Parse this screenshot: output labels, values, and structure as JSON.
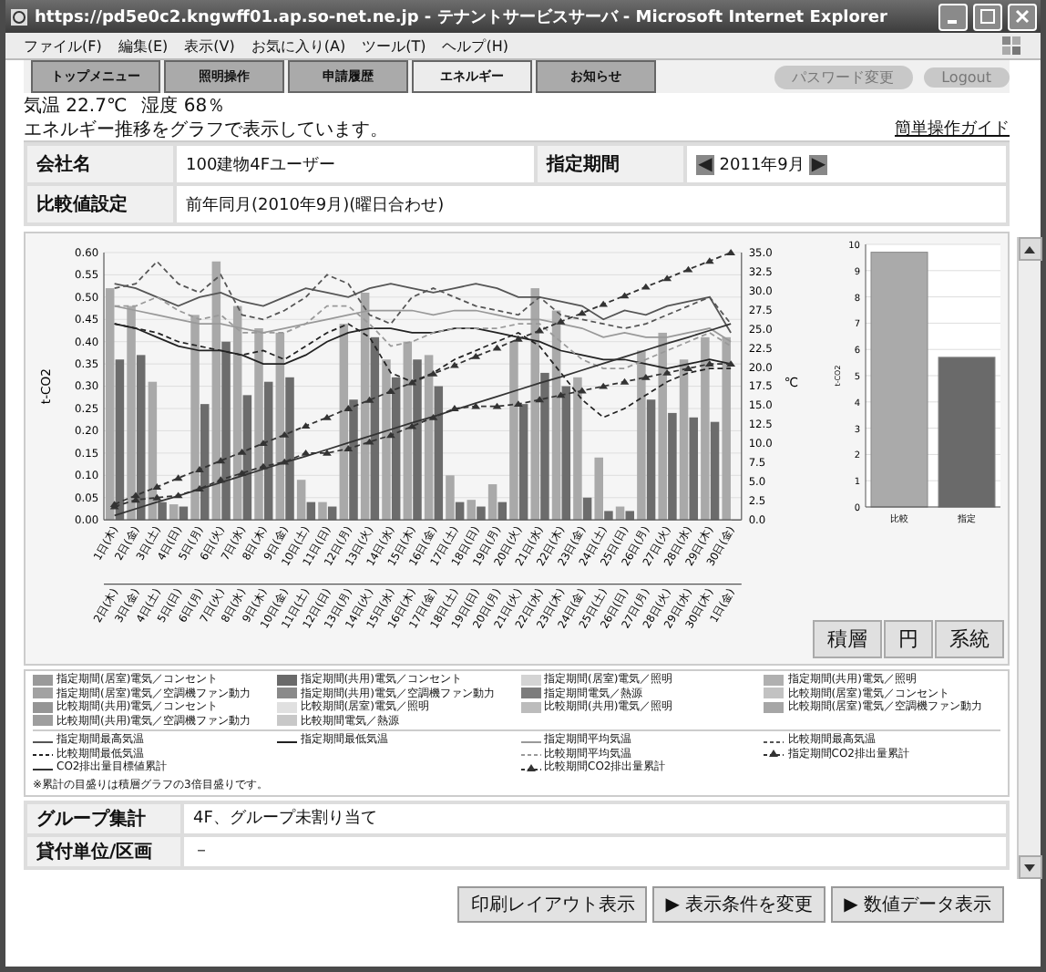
{
  "window": {
    "title": "https://pd5e0c2.kngwff01.ap.so-net.ne.jp - テナントサービスサーバ - Microsoft Internet Explorer"
  },
  "menu": [
    "ファイル(F)",
    "編集(E)",
    "表示(V)",
    "お気に入り(A)",
    "ツール(T)",
    "ヘルプ(H)"
  ],
  "nav_tabs": [
    {
      "label": "トップメニュー",
      "selected": false
    },
    {
      "label": "照明操作",
      "selected": false
    },
    {
      "label": "申請履歴",
      "selected": false
    },
    {
      "label": "エネルギー",
      "selected": true
    },
    {
      "label": "お知らせ",
      "selected": false
    }
  ],
  "nav_buttons": [
    "パスワード変更",
    "Logout"
  ],
  "weather": {
    "temperature": "気温 22.7℃",
    "humidity": "湿度 68％"
  },
  "heading": "エネルギー推移をグラフで表示しています。",
  "guide_link": "簡単操作ガイド",
  "info": {
    "company_label": "会社名",
    "company": "100建物4Fユーザー",
    "period_label": "指定期間",
    "prev": "◀",
    "period": "2011年9月",
    "next": "▶",
    "compare_label": "比較値設定",
    "compare": "前年同月(2010年9月)(曜日合わせ)"
  },
  "energy_chart": {
    "chart_data": {
      "type": "bar",
      "ylabel": "t-CO2",
      "grid": true,
      "categories": [
        "1日(木)",
        "2日(金)",
        "3日(土)",
        "4日(日)",
        "5日(月)",
        "6日(火)",
        "7日(水)",
        "8日(木)",
        "9日(金)",
        "10日(土)",
        "11日(日)",
        "12日(月)",
        "13日(火)",
        "14日(水)",
        "15日(木)",
        "16日(金)",
        "17日(土)",
        "18日(日)",
        "19日(月)",
        "20日(火)",
        "21日(水)",
        "22日(木)",
        "23日(金)",
        "24日(土)",
        "25日(日)",
        "26日(月)",
        "27日(火)",
        "28日(水)",
        "29日(木)",
        "30日(金)"
      ],
      "series": [
        {
          "type": "bar",
          "color": "#a9a9a9",
          "values": [
            0.52,
            0.48,
            0.31,
            0.035,
            0.46,
            0.58,
            0.48,
            0.43,
            0.42,
            0.09,
            0.04,
            0.44,
            0.51,
            0.36,
            0.4,
            0.37,
            0.1,
            0.045,
            0.08,
            0.4,
            0.52,
            0.47,
            0.32,
            0.14,
            0.03,
            0.38,
            0.42,
            0.36,
            0.41,
            0.41
          ]
        },
        {
          "type": "bar",
          "color": "#6c6c6c",
          "values": [
            0.36,
            0.37,
            0.04,
            0.03,
            0.26,
            0.4,
            0.28,
            0.31,
            0.32,
            0.04,
            0.03,
            0.27,
            0.41,
            0.32,
            0.36,
            0.3,
            0.04,
            0.03,
            0.04,
            0.26,
            0.33,
            0.3,
            0.05,
            0.02,
            0.02,
            0.27,
            0.24,
            0.23,
            0.22,
            0.0
          ]
        },
        {
          "type": "line",
          "name": "指定期間最高気温",
          "color": "#555555",
          "line_style": "solid",
          "values": [
            0.53,
            0.52,
            0.5,
            0.48,
            0.5,
            0.51,
            0.49,
            0.48,
            0.5,
            0.52,
            0.51,
            0.5,
            0.52,
            0.53,
            0.52,
            0.51,
            0.52,
            0.53,
            0.52,
            0.5,
            0.5,
            0.49,
            0.48,
            0.45,
            0.47,
            0.46,
            0.48,
            0.49,
            0.5,
            0.42
          ]
        },
        {
          "type": "line",
          "name": "指定期間最低気温",
          "color": "#222222",
          "line_style": "solid",
          "values": [
            0.44,
            0.43,
            0.41,
            0.39,
            0.38,
            0.38,
            0.37,
            0.35,
            0.35,
            0.37,
            0.4,
            0.42,
            0.43,
            0.43,
            0.42,
            0.42,
            0.43,
            0.43,
            0.42,
            0.41,
            0.4,
            0.38,
            0.37,
            0.36,
            0.36,
            0.35,
            0.34,
            0.35,
            0.36,
            0.35
          ]
        },
        {
          "type": "line",
          "name": "指定期間平均気温",
          "color": "#999999",
          "line_style": "solid",
          "values": [
            0.48,
            0.47,
            0.46,
            0.45,
            0.44,
            0.44,
            0.43,
            0.42,
            0.43,
            0.44,
            0.45,
            0.46,
            0.47,
            0.47,
            0.47,
            0.46,
            0.47,
            0.47,
            0.46,
            0.45,
            0.45,
            0.44,
            0.43,
            0.41,
            0.42,
            0.41,
            0.41,
            0.42,
            0.43,
            0.4
          ]
        },
        {
          "type": "line",
          "name": "比較期間最高気温",
          "color": "#555555",
          "line_style": "dashed",
          "values": [
            0.52,
            0.53,
            0.58,
            0.53,
            0.51,
            0.55,
            0.46,
            0.45,
            0.47,
            0.5,
            0.55,
            0.53,
            0.46,
            0.44,
            0.5,
            0.52,
            0.5,
            0.48,
            0.47,
            0.46,
            0.5,
            0.46,
            0.45,
            0.44,
            0.43,
            0.44,
            0.46,
            0.48,
            0.5,
            0.44
          ]
        },
        {
          "type": "line",
          "name": "比較期間最低気温",
          "color": "#222222",
          "line_style": "dashed",
          "values": [
            0.44,
            0.43,
            0.42,
            0.4,
            0.39,
            0.38,
            0.37,
            0.38,
            0.36,
            0.39,
            0.42,
            0.44,
            0.41,
            0.33,
            0.31,
            0.33,
            0.36,
            0.38,
            0.4,
            0.42,
            0.39,
            0.33,
            0.27,
            0.23,
            0.25,
            0.28,
            0.31,
            0.33,
            0.34,
            0.34
          ]
        },
        {
          "type": "line",
          "name": "比較期間平均気温",
          "color": "#999999",
          "line_style": "dashed",
          "values": [
            0.48,
            0.48,
            0.5,
            0.47,
            0.45,
            0.46,
            0.42,
            0.42,
            0.42,
            0.44,
            0.48,
            0.48,
            0.44,
            0.39,
            0.4,
            0.42,
            0.43,
            0.43,
            0.43,
            0.44,
            0.44,
            0.4,
            0.36,
            0.34,
            0.34,
            0.36,
            0.38,
            0.4,
            0.42,
            0.39
          ]
        },
        {
          "type": "line",
          "name": "指定期間CO2排出量累計",
          "color": "#333333",
          "line_style": "dashed",
          "marker": "triangle",
          "values": [
            0.035,
            0.055,
            0.074,
            0.094,
            0.113,
            0.133,
            0.152,
            0.172,
            0.191,
            0.211,
            0.23,
            0.25,
            0.269,
            0.289,
            0.308,
            0.328,
            0.347,
            0.367,
            0.386,
            0.406,
            0.425,
            0.445,
            0.464,
            0.484,
            0.503,
            0.523,
            0.542,
            0.562,
            0.581,
            0.6
          ]
        },
        {
          "type": "line",
          "name": "CO2排出量目標値累計",
          "color": "#333333",
          "line_style": "solid",
          "values": [
            0.01,
            0.025,
            0.04,
            0.054,
            0.069,
            0.084,
            0.099,
            0.114,
            0.129,
            0.143,
            0.158,
            0.173,
            0.188,
            0.203,
            0.218,
            0.232,
            0.247,
            0.262,
            0.277,
            0.292,
            0.307,
            0.321,
            0.336,
            0.351,
            0.366,
            0.381,
            0.396,
            0.41,
            0.425,
            0.44
          ]
        },
        {
          "type": "line",
          "name": "比較期間CO2排出量累計",
          "color": "#333333",
          "line_style": "dashed",
          "marker": "triangle",
          "values": [
            0.03,
            0.045,
            0.05,
            0.055,
            0.07,
            0.09,
            0.105,
            0.12,
            0.13,
            0.15,
            0.15,
            0.16,
            0.175,
            0.19,
            0.21,
            0.23,
            0.25,
            0.255,
            0.255,
            0.26,
            0.27,
            0.28,
            0.29,
            0.3,
            0.31,
            0.32,
            0.33,
            0.34,
            0.35,
            0.35
          ]
        }
      ],
      "ylim": [
        0,
        0.6
      ],
      "yticks": [
        {
          "value": 0.6,
          "label": "0.60"
        },
        {
          "value": 0.55,
          "label": "0.55"
        },
        {
          "value": 0.5,
          "label": "0.50"
        },
        {
          "value": 0.45,
          "label": "0.45"
        },
        {
          "value": 0.4,
          "label": "0.40"
        },
        {
          "value": 0.35,
          "label": "0.35"
        },
        {
          "value": 0.3,
          "label": "0.30"
        },
        {
          "value": 0.25,
          "label": "0.25"
        },
        {
          "value": 0.2,
          "label": "0.20"
        },
        {
          "value": 0.15,
          "label": "0.15"
        },
        {
          "value": 0.1,
          "label": "0.10"
        },
        {
          "value": 0.05,
          "label": "0.05"
        },
        {
          "value": 0,
          "label": "0.00"
        }
      ]
    },
    "right_axis": {
      "label": "℃",
      "ticks": [
        "35.0",
        "32.5",
        "30.0",
        "27.5",
        "25.0",
        "22.5",
        "20.0",
        "17.5",
        "15.0",
        "12.5",
        "10.0",
        "7.5",
        "5.0",
        "2.5",
        "0.0"
      ]
    },
    "comparison_dates": [
      "2日(木)",
      "3日(金)",
      "4日(土)",
      "5日(日)",
      "6日(月)",
      "7日(火)",
      "8日(水)",
      "9日(木)",
      "10日(金)",
      "11日(土)",
      "12日(日)",
      "13日(月)",
      "14日(火)",
      "15日(水)",
      "16日(木)",
      "17日(金)",
      "18日(土)",
      "19日(日)",
      "20日(月)",
      "21日(火)",
      "22日(水)",
      "23日(木)",
      "24日(金)",
      "25日(土)",
      "26日(日)",
      "27日(月)",
      "28日(火)",
      "29日(水)",
      "30日(木)",
      "1日(金)"
    ]
  },
  "total_chart": {
    "chart_data": {
      "type": "bar",
      "ylabel": "t-CO2",
      "grid": true,
      "categories": [
        "比較",
        "指定"
      ],
      "values": [
        9.7,
        5.7
      ],
      "ylim": [
        0,
        10
      ],
      "yticks": [
        10,
        9,
        8,
        7,
        6,
        5,
        4,
        3,
        2,
        1,
        0
      ]
    }
  },
  "chart_buttons": [
    "積層",
    "円",
    "系統"
  ],
  "legend": {
    "bar_items": [
      {
        "label": "指定期間(居室)電気／コンセント",
        "color": "#9a9a9a"
      },
      {
        "label": "指定期間(共用)電気／コンセント",
        "color": "#6a6a6a"
      },
      {
        "label": "指定期間(居室)電気／照明",
        "color": "#d4d4d4"
      },
      {
        "label": "指定期間(共用)電気／照明",
        "color": "#b0b0b0"
      },
      {
        "label": "指定期間(居室)電気／空調機ファン動力",
        "color": "#a2a2a2"
      },
      {
        "label": "指定期間(共用)電気／空調機ファン動力",
        "color": "#8a8a8a"
      },
      {
        "label": "指定期間電気／熱源",
        "color": "#7c7c7c"
      },
      {
        "label": "比較期間(居室)電気／コンセント",
        "color": "#c2c2c2"
      },
      {
        "label": "比較期間(共用)電気／コンセント",
        "color": "#959595"
      },
      {
        "label": "比較期間(居室)電気／照明",
        "color": "#e0e0e0"
      },
      {
        "label": "比較期間(共用)電気／照明",
        "color": "#bcbcbc"
      },
      {
        "label": "比較期間(居室)電気／空調機ファン動力",
        "color": "#a6a6a6"
      },
      {
        "label": "比較期間(共用)電気／空調機ファン動力",
        "color": "#9e9e9e"
      },
      {
        "label": "比較期間電気／熱源",
        "color": "#c8c8c8"
      }
    ],
    "note": "※累計の目盛りは積層グラフの3倍目盛りです。"
  },
  "details": [
    {
      "label": "グループ集計",
      "value": "4F、グループ未割り当て"
    },
    {
      "label": "貸付単位/区画",
      "value": "－"
    }
  ],
  "footer_buttons": [
    "印刷レイアウト表示",
    "▶ 表示条件を変更",
    "▶ 数値データ表示"
  ]
}
